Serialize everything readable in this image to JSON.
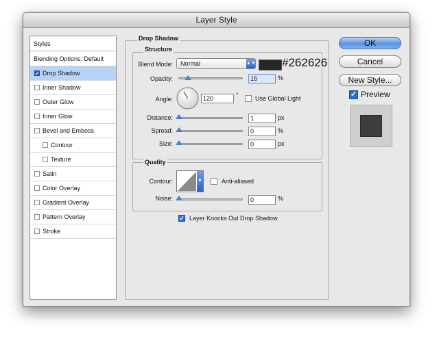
{
  "window": {
    "title": "Layer Style"
  },
  "styles_panel": {
    "header": "Styles",
    "items": [
      {
        "label": "Blending Options: Default",
        "checkbox": false,
        "checked": false,
        "indent": false,
        "selected": false
      },
      {
        "label": "Drop Shadow",
        "checkbox": true,
        "checked": true,
        "indent": false,
        "selected": true
      },
      {
        "label": "Inner Shadow",
        "checkbox": true,
        "checked": false,
        "indent": false,
        "selected": false
      },
      {
        "label": "Outer Glow",
        "checkbox": true,
        "checked": false,
        "indent": false,
        "selected": false
      },
      {
        "label": "Inner Glow",
        "checkbox": true,
        "checked": false,
        "indent": false,
        "selected": false
      },
      {
        "label": "Bevel and Emboss",
        "checkbox": true,
        "checked": false,
        "indent": false,
        "selected": false
      },
      {
        "label": "Contour",
        "checkbox": true,
        "checked": false,
        "indent": true,
        "selected": false
      },
      {
        "label": "Texture",
        "checkbox": true,
        "checked": false,
        "indent": true,
        "selected": false
      },
      {
        "label": "Satin",
        "checkbox": true,
        "checked": false,
        "indent": false,
        "selected": false
      },
      {
        "label": "Color Overlay",
        "checkbox": true,
        "checked": false,
        "indent": false,
        "selected": false
      },
      {
        "label": "Gradient Overlay",
        "checkbox": true,
        "checked": false,
        "indent": false,
        "selected": false
      },
      {
        "label": "Pattern Overlay",
        "checkbox": true,
        "checked": false,
        "indent": false,
        "selected": false
      },
      {
        "label": "Stroke",
        "checkbox": true,
        "checked": false,
        "indent": false,
        "selected": false
      }
    ]
  },
  "drop_shadow": {
    "title": "Drop Shadow",
    "structure": {
      "title": "Structure",
      "blend_mode_label": "Blend Mode:",
      "blend_mode_value": "Normal",
      "color_hex": "#262626",
      "opacity_label": "Opacity:",
      "opacity_value": "15",
      "opacity_unit": "%",
      "opacity_level": 0.15,
      "angle_label": "Angle:",
      "angle_value": "120",
      "angle_unit": "°",
      "angle_degrees": 120,
      "global_light_label": "Use Global Light",
      "global_light_checked": false,
      "distance_label": "Distance:",
      "distance_value": "1",
      "distance_unit": "px",
      "spread_label": "Spread:",
      "spread_value": "0",
      "spread_unit": "%",
      "size_label": "Size:",
      "size_value": "0",
      "size_unit": "px"
    },
    "quality": {
      "title": "Quality",
      "contour_label": "Contour:",
      "anti_aliased_label": "Anti-aliased",
      "anti_aliased_checked": false,
      "noise_label": "Noise:",
      "noise_value": "0",
      "noise_unit": "%"
    },
    "knockout_label": "Layer Knocks Out Drop Shadow",
    "knockout_checked": true
  },
  "buttons": {
    "ok": "OK",
    "cancel": "Cancel",
    "new_style": "New Style...",
    "preview": "Preview",
    "preview_checked": true
  },
  "colors": {
    "shadow_swatch": "#262626",
    "selection": "#b7d3f5",
    "accent": "#2a6fd6",
    "preview_square": "#3d3d3d"
  }
}
